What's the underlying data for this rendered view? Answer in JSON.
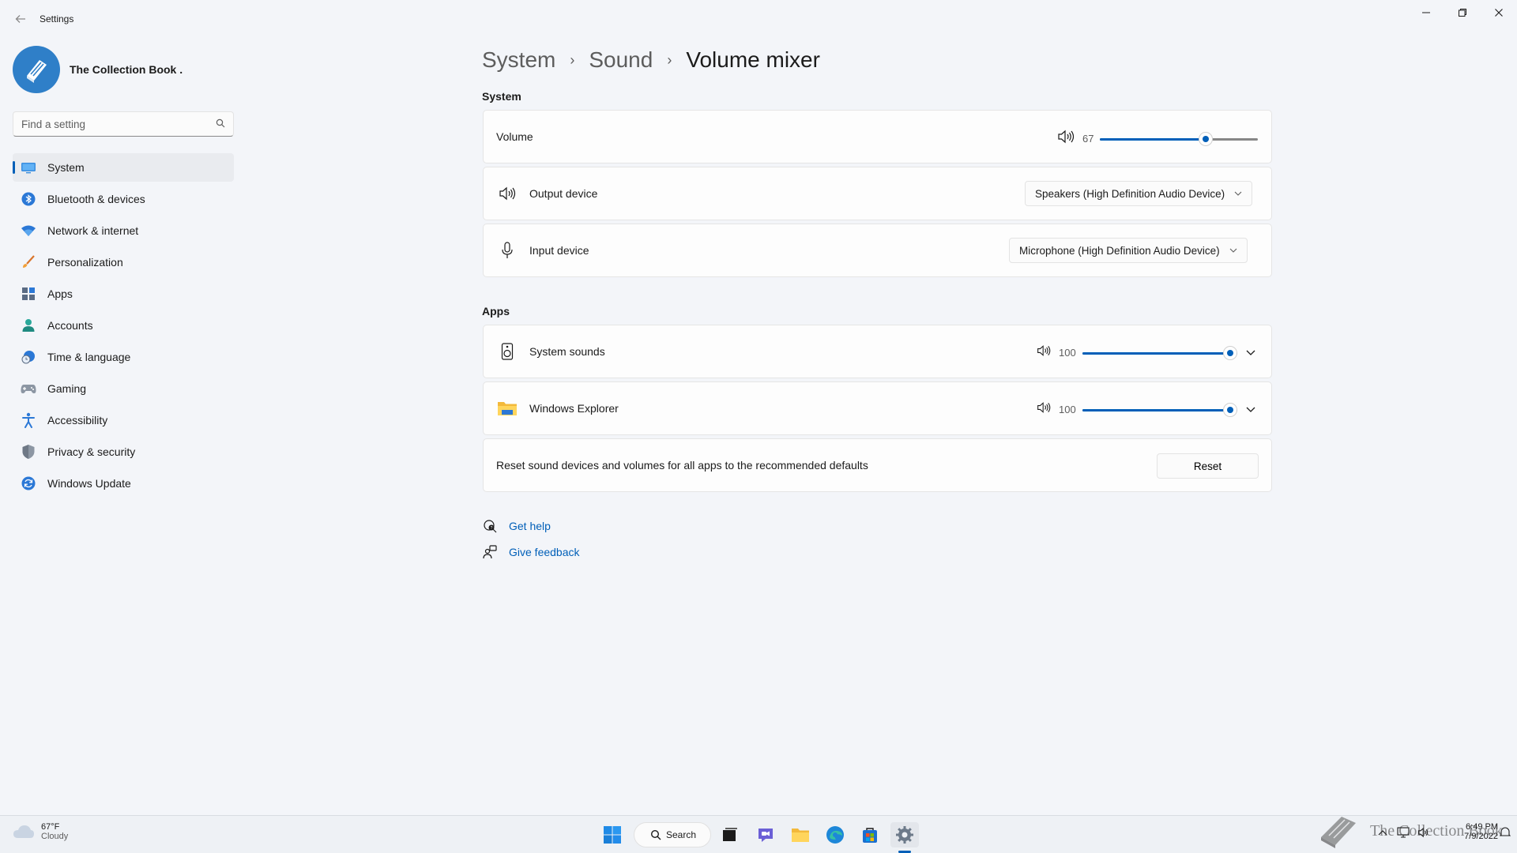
{
  "window": {
    "app_title": "Settings"
  },
  "profile": {
    "name": "The Collection Book ."
  },
  "search": {
    "placeholder": "Find a setting"
  },
  "sidebar": {
    "items": [
      {
        "label": "System",
        "icon": "system-icon",
        "active": true
      },
      {
        "label": "Bluetooth & devices",
        "icon": "bluetooth-icon"
      },
      {
        "label": "Network & internet",
        "icon": "wifi-icon"
      },
      {
        "label": "Personalization",
        "icon": "brush-icon"
      },
      {
        "label": "Apps",
        "icon": "apps-icon"
      },
      {
        "label": "Accounts",
        "icon": "account-icon"
      },
      {
        "label": "Time & language",
        "icon": "clock-globe-icon"
      },
      {
        "label": "Gaming",
        "icon": "gamepad-icon"
      },
      {
        "label": "Accessibility",
        "icon": "accessibility-icon"
      },
      {
        "label": "Privacy & security",
        "icon": "shield-icon"
      },
      {
        "label": "Windows Update",
        "icon": "update-icon"
      }
    ]
  },
  "breadcrumb": {
    "items": [
      "System",
      "Sound",
      "Volume mixer"
    ],
    "separator": "›"
  },
  "system_section": {
    "label": "System",
    "volume": {
      "label": "Volume",
      "value": "67",
      "level": 67
    },
    "output": {
      "label": "Output device",
      "selected": "Speakers (High Definition Audio Device)"
    },
    "input": {
      "label": "Input device",
      "selected": "Microphone (High Definition Audio Device)"
    }
  },
  "apps_section": {
    "label": "Apps",
    "apps": [
      {
        "name": "System sounds",
        "value": "100",
        "level": 100,
        "icon": "speaker-device-icon"
      },
      {
        "name": "Windows Explorer",
        "value": "100",
        "level": 100,
        "icon": "folder-icon"
      }
    ],
    "reset": {
      "text": "Reset sound devices and volumes for all apps to the recommended defaults",
      "button": "Reset"
    }
  },
  "help": {
    "get_help": "Get help",
    "give_feedback": "Give feedback"
  },
  "taskbar": {
    "weather_temp": "67°F",
    "weather_desc": "Cloudy",
    "search_label": "Search",
    "time": "6:49 PM",
    "date": "7/9/2022",
    "watermark": "The Collection Book"
  },
  "colors": {
    "accent": "#005fb8",
    "background": "#f3f5f9",
    "card": "#fdfdfd"
  }
}
